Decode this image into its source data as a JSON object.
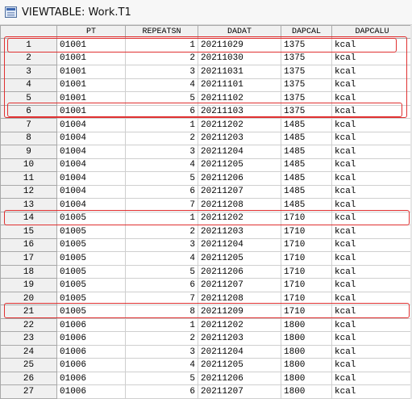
{
  "window": {
    "title": "VIEWTABLE: Work.T1"
  },
  "table": {
    "columns": [
      "",
      "PT",
      "REPEATSN",
      "DADAT",
      "DAPCAL",
      "DAPCALU"
    ],
    "rows": [
      [
        "1",
        "01001",
        "1",
        "20211029",
        "1375",
        "kcal"
      ],
      [
        "2",
        "01001",
        "2",
        "20211030",
        "1375",
        "kcal"
      ],
      [
        "3",
        "01001",
        "3",
        "20211031",
        "1375",
        "kcal"
      ],
      [
        "4",
        "01001",
        "4",
        "20211101",
        "1375",
        "kcal"
      ],
      [
        "5",
        "01001",
        "5",
        "20211102",
        "1375",
        "kcal"
      ],
      [
        "6",
        "01001",
        "6",
        "20211103",
        "1375",
        "kcal"
      ],
      [
        "7",
        "01004",
        "1",
        "20211202",
        "1485",
        "kcal"
      ],
      [
        "8",
        "01004",
        "2",
        "20211203",
        "1485",
        "kcal"
      ],
      [
        "9",
        "01004",
        "3",
        "20211204",
        "1485",
        "kcal"
      ],
      [
        "10",
        "01004",
        "4",
        "20211205",
        "1485",
        "kcal"
      ],
      [
        "11",
        "01004",
        "5",
        "20211206",
        "1485",
        "kcal"
      ],
      [
        "12",
        "01004",
        "6",
        "20211207",
        "1485",
        "kcal"
      ],
      [
        "13",
        "01004",
        "7",
        "20211208",
        "1485",
        "kcal"
      ],
      [
        "14",
        "01005",
        "1",
        "20211202",
        "1710",
        "kcal"
      ],
      [
        "15",
        "01005",
        "2",
        "20211203",
        "1710",
        "kcal"
      ],
      [
        "16",
        "01005",
        "3",
        "20211204",
        "1710",
        "kcal"
      ],
      [
        "17",
        "01005",
        "4",
        "20211205",
        "1710",
        "kcal"
      ],
      [
        "18",
        "01005",
        "5",
        "20211206",
        "1710",
        "kcal"
      ],
      [
        "19",
        "01005",
        "6",
        "20211207",
        "1710",
        "kcal"
      ],
      [
        "20",
        "01005",
        "7",
        "20211208",
        "1710",
        "kcal"
      ],
      [
        "21",
        "01005",
        "8",
        "20211209",
        "1710",
        "kcal"
      ],
      [
        "22",
        "01006",
        "1",
        "20211202",
        "1800",
        "kcal"
      ],
      [
        "23",
        "01006",
        "2",
        "20211203",
        "1800",
        "kcal"
      ],
      [
        "24",
        "01006",
        "3",
        "20211204",
        "1800",
        "kcal"
      ],
      [
        "25",
        "01006",
        "4",
        "20211205",
        "1800",
        "kcal"
      ],
      [
        "26",
        "01006",
        "5",
        "20211206",
        "1800",
        "kcal"
      ],
      [
        "27",
        "01006",
        "6",
        "20211207",
        "1800",
        "kcal"
      ]
    ]
  },
  "annotation_color": "#e03131"
}
